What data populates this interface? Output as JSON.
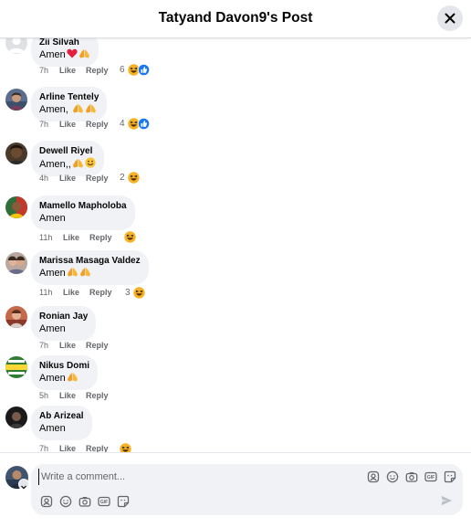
{
  "header": {
    "title": "Tatyand Davon9's Post",
    "close_icon": "close-icon"
  },
  "actions": {
    "like": "Like",
    "reply": "Reply"
  },
  "comments": [
    {
      "author": "Zii Silvah",
      "text": "Amen",
      "emoji": [
        "heart",
        "pray"
      ],
      "time": "7h",
      "reaction_count": "6",
      "reactions": [
        "haha",
        "like"
      ],
      "avatar": "default-avatar"
    },
    {
      "author": "Arline Tentely",
      "text": "Amen, ",
      "emoji": [
        "pray",
        "pray"
      ],
      "time": "7h",
      "reaction_count": "4",
      "reactions": [
        "haha",
        "like"
      ],
      "avatar": "photo-avatar"
    },
    {
      "author": "Dewell Riyel",
      "text": "Amen,,",
      "emoji": [
        "pray",
        "grin"
      ],
      "time": "4h",
      "reaction_count": "2",
      "reactions": [
        "haha"
      ],
      "avatar": "photo-avatar"
    },
    {
      "author": "Mamello Mapholoba",
      "text": "Amen",
      "emoji": [],
      "time": "11h",
      "reaction_count": "",
      "reactions": [
        "haha"
      ],
      "avatar": "photo-avatar"
    },
    {
      "author": "Marissa Masaga Valdez",
      "text": "Amen",
      "emoji": [
        "pray",
        "pray"
      ],
      "time": "11h",
      "reaction_count": "3",
      "reactions": [
        "haha"
      ],
      "avatar": "photo-avatar"
    },
    {
      "author": "Ronian Jay",
      "text": "Amen",
      "emoji": [],
      "time": "7h",
      "reaction_count": "",
      "reactions": [],
      "avatar": "photo-avatar"
    },
    {
      "author": "Nikus Domi",
      "text": "Amen",
      "emoji": [
        "pray"
      ],
      "time": "5h",
      "reaction_count": "",
      "reactions": [],
      "avatar": "logo-avatar"
    },
    {
      "author": "Ab Arizeal",
      "text": "Amen",
      "emoji": [],
      "time": "7h",
      "reaction_count": "",
      "reactions": [
        "haha"
      ],
      "avatar": "photo-avatar"
    }
  ],
  "composer": {
    "placeholder": "Write a comment...",
    "value": "",
    "inline_icons": [
      "avatar-sticker-icon",
      "emoji-icon",
      "camera-icon",
      "gif-icon",
      "sticker-icon"
    ],
    "bottom_icons": [
      "avatar-sticker-icon",
      "emoji-icon",
      "camera-icon",
      "gif-icon",
      "sticker-icon"
    ],
    "send_icon": "send-icon"
  },
  "colors": {
    "bubble": "#f0f2f5",
    "meta_text": "#65676b",
    "like_blue": "#1877f2",
    "haha_yellow": "#f7b125",
    "heart_red": "#e41e3f"
  }
}
